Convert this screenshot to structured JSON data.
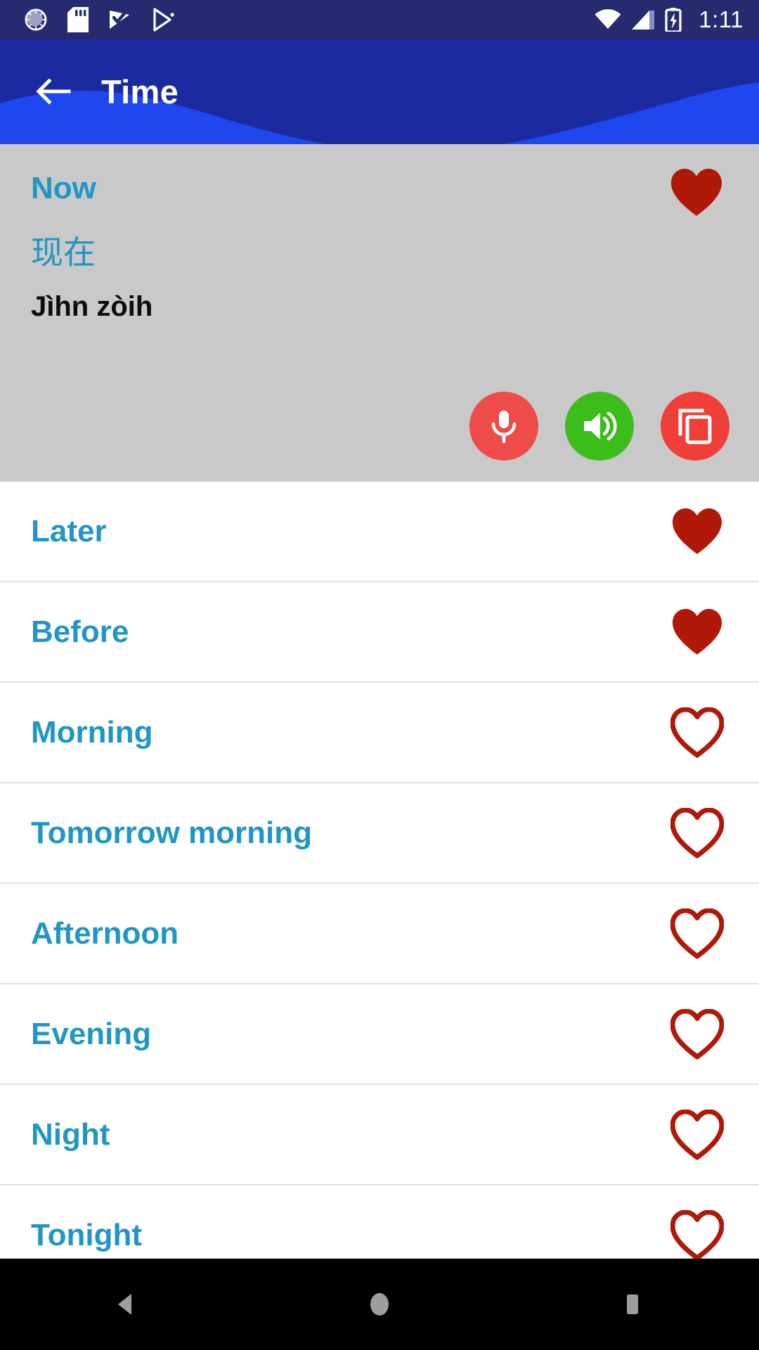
{
  "status_bar": {
    "time": "1:11",
    "left_icons": [
      "sync-progress-icon",
      "sd-card-icon",
      "play-movies-icon",
      "play-store-icon"
    ],
    "right_icons": [
      "wifi-icon",
      "cellular-signal-icon",
      "battery-charging-icon"
    ],
    "background_color": "#252B6E"
  },
  "app_bar": {
    "title": "Time",
    "back_icon": "back-arrow-icon",
    "color_dark": "#1B2A9E",
    "color_light": "#1F47F0"
  },
  "selected_card": {
    "english": "Now",
    "native": "现在",
    "romanization": "Jìhn zòih",
    "favorited": true,
    "background_color": "#C9C9C9",
    "text_color": "#2196C4",
    "actions": [
      {
        "name": "record-button",
        "icon": "microphone-icon",
        "color": "#EE4B4B"
      },
      {
        "name": "play-audio-button",
        "icon": "speaker-icon",
        "color": "#3DBD1C"
      },
      {
        "name": "copy-button",
        "icon": "copy-icon",
        "color": "#EE4038"
      }
    ]
  },
  "list": {
    "heart_color": "#B01808",
    "items": [
      {
        "label": "Later",
        "favorited": true
      },
      {
        "label": "Before",
        "favorited": true
      },
      {
        "label": "Morning",
        "favorited": false
      },
      {
        "label": "Tomorrow morning",
        "favorited": false
      },
      {
        "label": "Afternoon",
        "favorited": false
      },
      {
        "label": "Evening",
        "favorited": false
      },
      {
        "label": "Night",
        "favorited": false
      },
      {
        "label": "Tonight",
        "favorited": false
      }
    ]
  },
  "nav_bar": {
    "buttons": [
      {
        "name": "nav-back-button",
        "icon": "triangle-back-icon"
      },
      {
        "name": "nav-home-button",
        "icon": "circle-home-icon"
      },
      {
        "name": "nav-recents-button",
        "icon": "square-recents-icon"
      }
    ]
  }
}
